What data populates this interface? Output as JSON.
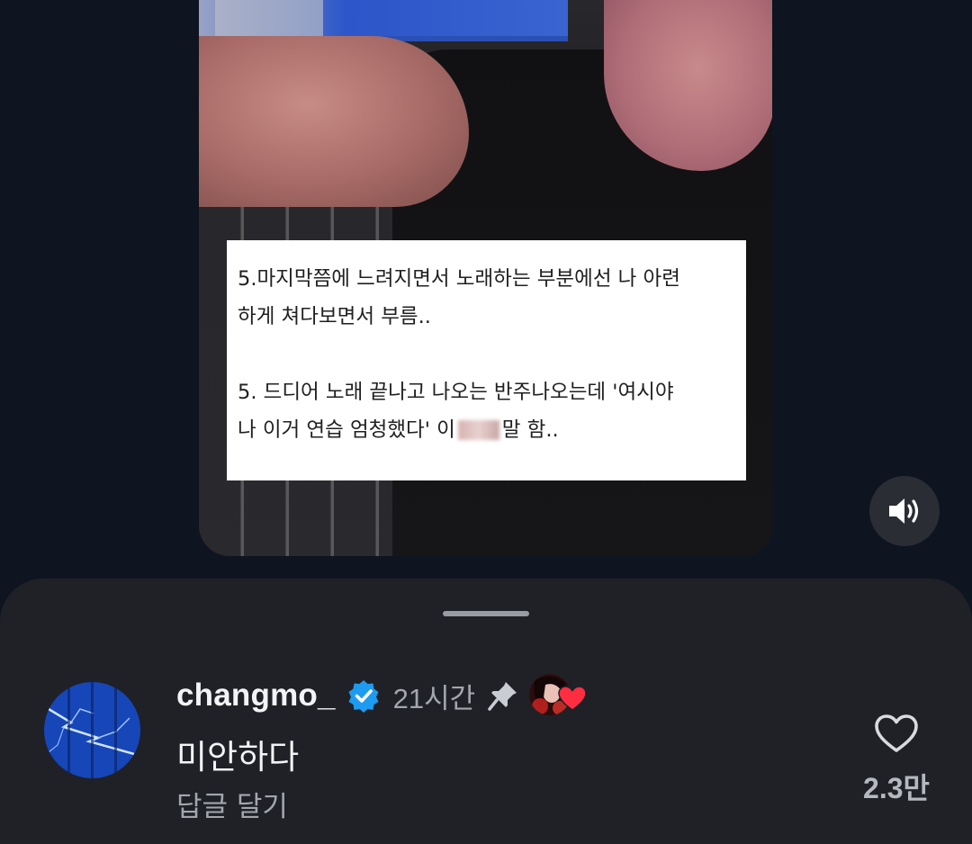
{
  "video": {
    "caption_lines": [
      "5.마지막쯤에 느려지면서 노래하는 부분에선 나 아련\n하게 쳐다보면서 부름..",
      "5. 드디어 노래 끝나고 나오는 반주나오는데 '여시야\n나 이거 연습 엄청했다' 이"
    ],
    "caption_tail": "말 함.."
  },
  "sound_button": {
    "icon": "speaker-volume-icon"
  },
  "comment": {
    "username": "changmo_",
    "time": "21시간",
    "text": "미안하다",
    "reply_label": "답글 달기",
    "like_count": "2.3만"
  },
  "colors": {
    "background": "#0e1420",
    "sheet": "#1f2127",
    "verified": "#1d9bf0",
    "creator_heart": "#ff2d42"
  }
}
